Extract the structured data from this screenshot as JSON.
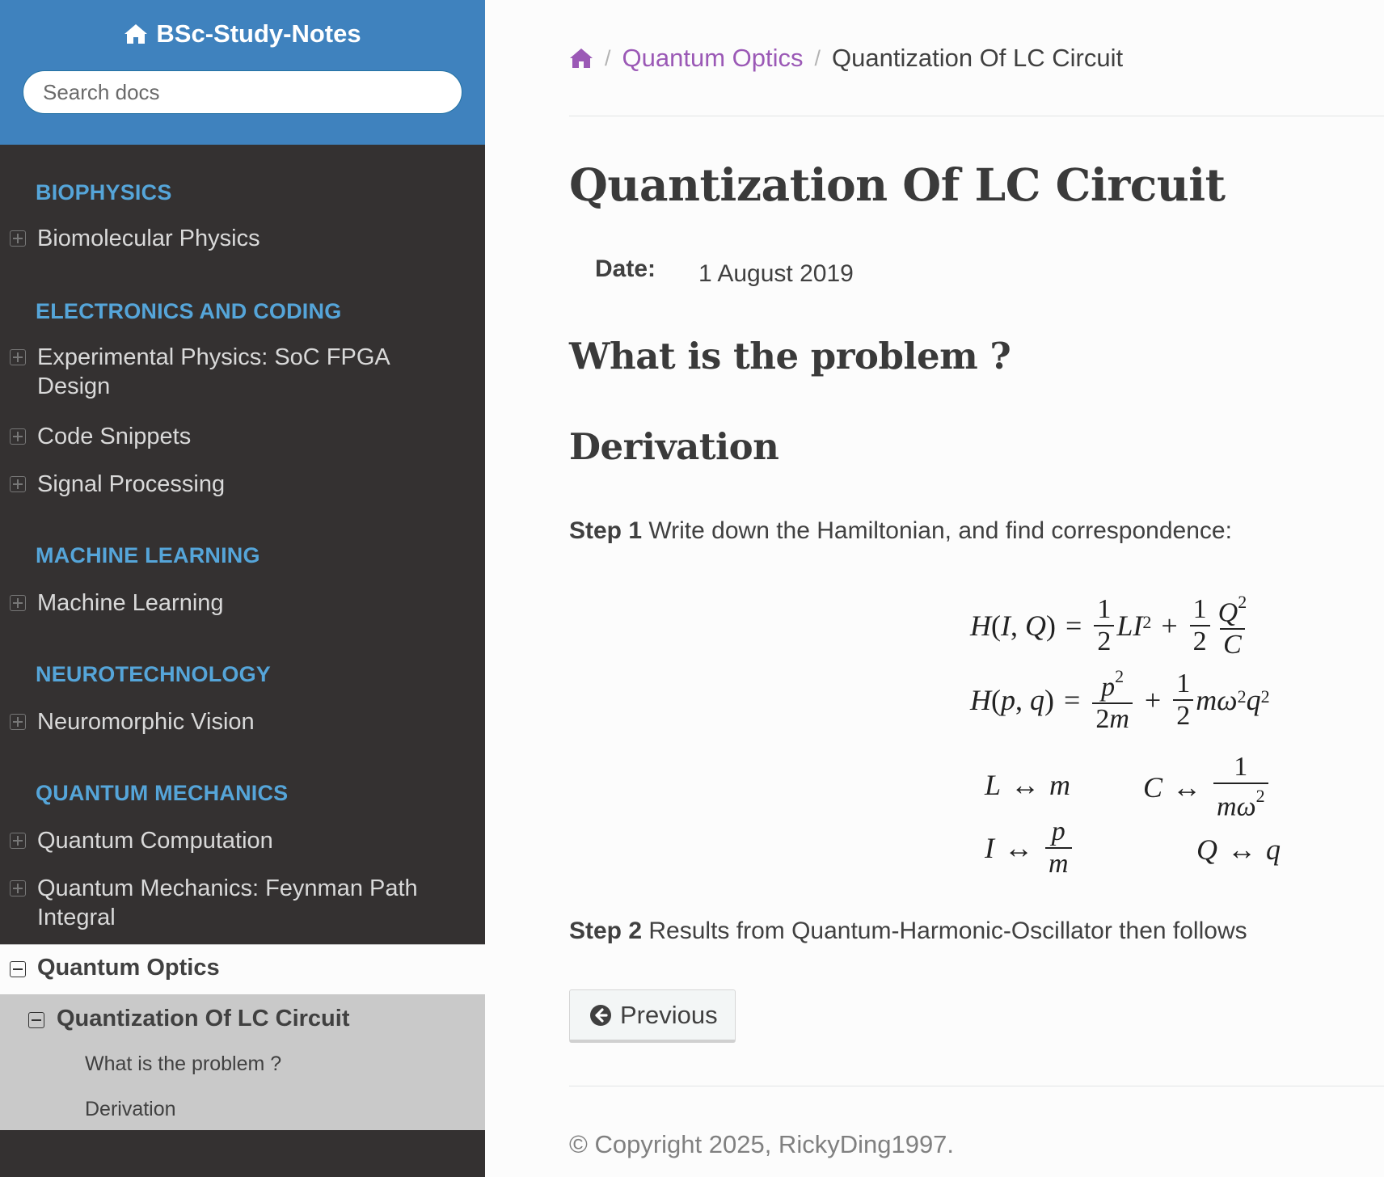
{
  "sidebar": {
    "project_name": "BSc-Study-Notes",
    "search_placeholder": "Search docs",
    "captions": [
      "BIOPHYSICS",
      "ELECTRONICS AND CODING",
      "MACHINE LEARNING",
      "NEUROTECHNOLOGY",
      "QUANTUM MECHANICS"
    ],
    "items": [
      "Biomolecular Physics",
      "Experimental Physics: SoC FPGA Design",
      "Code Snippets",
      "Signal Processing",
      "Machine Learning",
      "Neuromorphic Vision",
      "Quantum Computation",
      "Quantum Mechanics: Feynman Path Integral"
    ],
    "current_section": "Quantum Optics",
    "current_page": "Quantization Of LC Circuit",
    "current_subsections": [
      "What is the problem ?",
      "Derivation"
    ]
  },
  "breadcrumb": {
    "parent": "Quantum Optics",
    "current": "Quantization Of LC Circuit"
  },
  "page": {
    "title": "Quantization Of LC Circuit",
    "date_label": "Date:",
    "date_value": "1 August 2019",
    "section1": "What is the problem ?",
    "section2": "Derivation",
    "step1_label": "Step 1",
    "step1_text": "Write down the Hamiltonian, and find correspondence:",
    "step2_label": "Step 2",
    "step2_text": "Results from Quantum-Harmonic-Oscillator then follows"
  },
  "footer": {
    "previous_label": "Previous",
    "copyright": "© Copyright 2025, RickyDing1997."
  },
  "colors": {
    "sidebar_header": "#3f82be",
    "sidebar_bg": "#343131",
    "caption": "#55a5d9",
    "link": "#9b59b6"
  }
}
